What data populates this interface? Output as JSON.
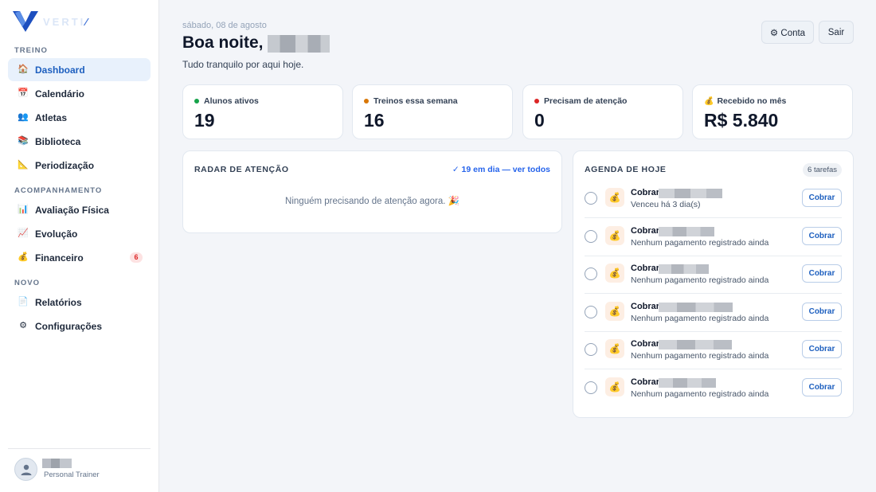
{
  "brand": {
    "name": "VERTI",
    "slash": "⁄",
    "accent": "#1d5fbf"
  },
  "sidebar": {
    "sections": [
      {
        "label": "TREINO",
        "items": [
          {
            "label": "Dashboard",
            "icon": "house-icon",
            "active": true
          },
          {
            "label": "Calendário",
            "icon": "calendar-icon"
          },
          {
            "label": "Atletas",
            "icon": "people-icon"
          },
          {
            "label": "Biblioteca",
            "icon": "books-icon"
          },
          {
            "label": "Periodização",
            "icon": "ruler-icon"
          }
        ]
      },
      {
        "label": "ACOMPANHAMENTO",
        "items": [
          {
            "label": "Avaliação Física",
            "icon": "bar-chart-icon"
          },
          {
            "label": "Evolução",
            "icon": "trend-chart-icon"
          },
          {
            "label": "Financeiro",
            "icon": "money-bag-icon",
            "badge": "6"
          }
        ]
      },
      {
        "label": "NOVO",
        "items": [
          {
            "label": "Relatórios",
            "icon": "document-icon"
          },
          {
            "label": "Configurações",
            "icon": "gear-icon"
          }
        ]
      }
    ],
    "user": {
      "role": "Personal Trainer"
    }
  },
  "header": {
    "date": "sábado, 08 de agosto",
    "greeting": "Boa noite,",
    "subtitle": "Tudo tranquilo por aqui hoje.",
    "account_button": "⚙ Conta",
    "logout_button": "Sair"
  },
  "stats": [
    {
      "label": "Alunos ativos",
      "value": "19",
      "dot_color": "#16a34a"
    },
    {
      "label": "Treinos essa semana",
      "value": "16",
      "dot_color": "#d97706"
    },
    {
      "label": "Precisam de atenção",
      "value": "0",
      "dot_color": "#dc2626"
    },
    {
      "label": "Recebido no mês",
      "value": "R$ 5.840",
      "icon": "💰"
    }
  ],
  "radar": {
    "title": "RADAR DE ATENÇÃO",
    "link": "✓ 19 em dia — ver todos",
    "empty": "Ninguém precisando de atenção agora. 🎉"
  },
  "agenda": {
    "title": "AGENDA DE HOJE",
    "count": "6 tarefas",
    "tasks": [
      {
        "title": "Cobrar",
        "subtitle": "Venceu há 3 dia(s)",
        "action": "Cobrar"
      },
      {
        "title": "Cobrar",
        "subtitle": "Nenhum pagamento registrado ainda",
        "action": "Cobrar"
      },
      {
        "title": "Cobrar",
        "subtitle": "Nenhum pagamento registrado ainda",
        "action": "Cobrar"
      },
      {
        "title": "Cobrar",
        "subtitle": "Nenhum pagamento registrado ainda",
        "action": "Cobrar"
      },
      {
        "title": "Cobrar",
        "subtitle": "Nenhum pagamento registrado ainda",
        "action": "Cobrar"
      },
      {
        "title": "Cobrar",
        "subtitle": "Nenhum pagamento registrado ainda",
        "action": "Cobrar"
      }
    ]
  }
}
